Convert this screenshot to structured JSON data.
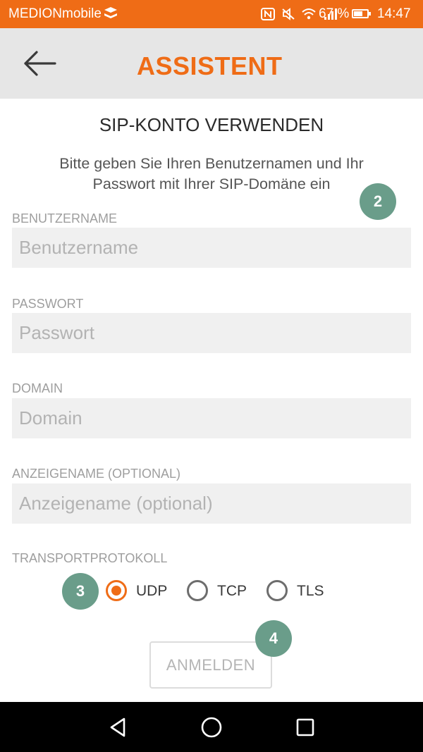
{
  "status_bar": {
    "carrier": "MEDIONmobile",
    "battery_percent": "67 %",
    "battery_level": 0.67,
    "time": "14:47",
    "icons": [
      "nfc-icon",
      "mute-icon",
      "wifi-icon",
      "signal-icon",
      "battery-icon"
    ]
  },
  "app_bar": {
    "title": "ASSISTENT",
    "back_icon": "back-arrow-icon"
  },
  "screen": {
    "heading": "SIP-KONTO VERWENDEN",
    "description": "Bitte geben Sie Ihren Benutzernamen und Ihr Passwort mit Ihrer SIP-Domäne ein"
  },
  "fields": {
    "username": {
      "label": "BENUTZERNAME",
      "placeholder": "Benutzername",
      "value": ""
    },
    "password": {
      "label": "PASSWORT",
      "placeholder": "Passwort",
      "value": ""
    },
    "domain": {
      "label": "DOMAIN",
      "placeholder": "Domain",
      "value": ""
    },
    "display_name": {
      "label": "ANZEIGENAME (OPTIONAL)",
      "placeholder": "Anzeigename (optional)",
      "value": ""
    }
  },
  "transport": {
    "label": "TRANSPORTPROTOKOLL",
    "options": [
      "UDP",
      "TCP",
      "TLS"
    ],
    "selected": "UDP"
  },
  "login_button": {
    "label": "ANMELDEN"
  },
  "annotations": [
    "2",
    "3",
    "4"
  ],
  "nav_bar": {
    "icons": [
      "back-triangle-icon",
      "home-circle-icon",
      "recents-square-icon"
    ]
  },
  "colors": {
    "accent": "#ef6c16",
    "app_bar_bg": "#e6e6e6",
    "field_bg": "#f0f0f0",
    "badge": "#6a9d8a"
  }
}
